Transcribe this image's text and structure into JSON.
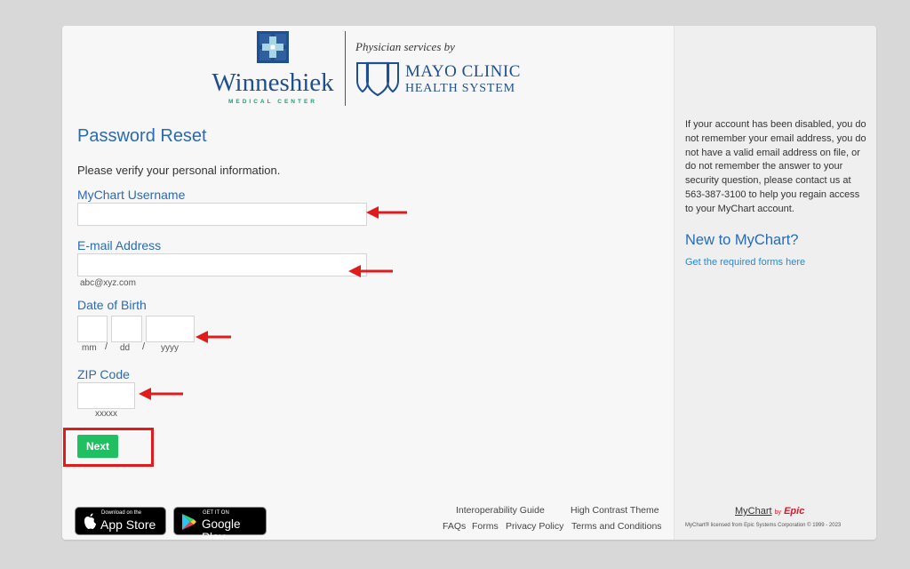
{
  "header": {
    "org_name": "Winneshiek",
    "org_sub": "MEDICAL CENTER",
    "tagline": "Physician services by",
    "partner_name": "MAYO CLINIC",
    "partner_sub": "HEALTH SYSTEM"
  },
  "form": {
    "title": "Password Reset",
    "intro": "Please verify your personal information.",
    "username_label": "MyChart Username",
    "username_value": "",
    "email_label": "E-mail Address",
    "email_value": "",
    "email_hint": "abc@xyz.com",
    "dob_label": "Date of Birth",
    "dob_month_hint": "mm",
    "dob_day_hint": "dd",
    "dob_year_hint": "yyyy",
    "dob_sep": "/",
    "zip_label": "ZIP Code",
    "zip_hint": "xxxxx",
    "next_label": "Next"
  },
  "footer": {
    "appstore_small": "Download on the",
    "appstore_big": "App Store",
    "googleplay_small": "GET IT ON",
    "googleplay_big": "Google Play",
    "links": {
      "interop": "Interoperability Guide",
      "contrast": "High Contrast Theme",
      "faqs": "FAQs",
      "forms": "Forms",
      "privacy": "Privacy Policy",
      "terms": "Terms and Conditions"
    }
  },
  "sidebar": {
    "help_text": "If your account has been disabled, you do not remember your email address, you do not have a valid email address on file, or do not remember the answer to your security question, please contact us at 563-387-3100 to help you regain access to your MyChart account.",
    "new_title": "New to MyChart?",
    "new_link": "Get the required forms here",
    "logo_mychart": "MyChart",
    "logo_by": "by",
    "logo_epic": "Epic",
    "copyright": "MyChart® licensed from Epic Systems Corporation © 1999 - 2023"
  },
  "colors": {
    "accent_blue": "#2a6ab3",
    "button_green": "#1fbf62",
    "annotation_red": "#e01b1b"
  }
}
